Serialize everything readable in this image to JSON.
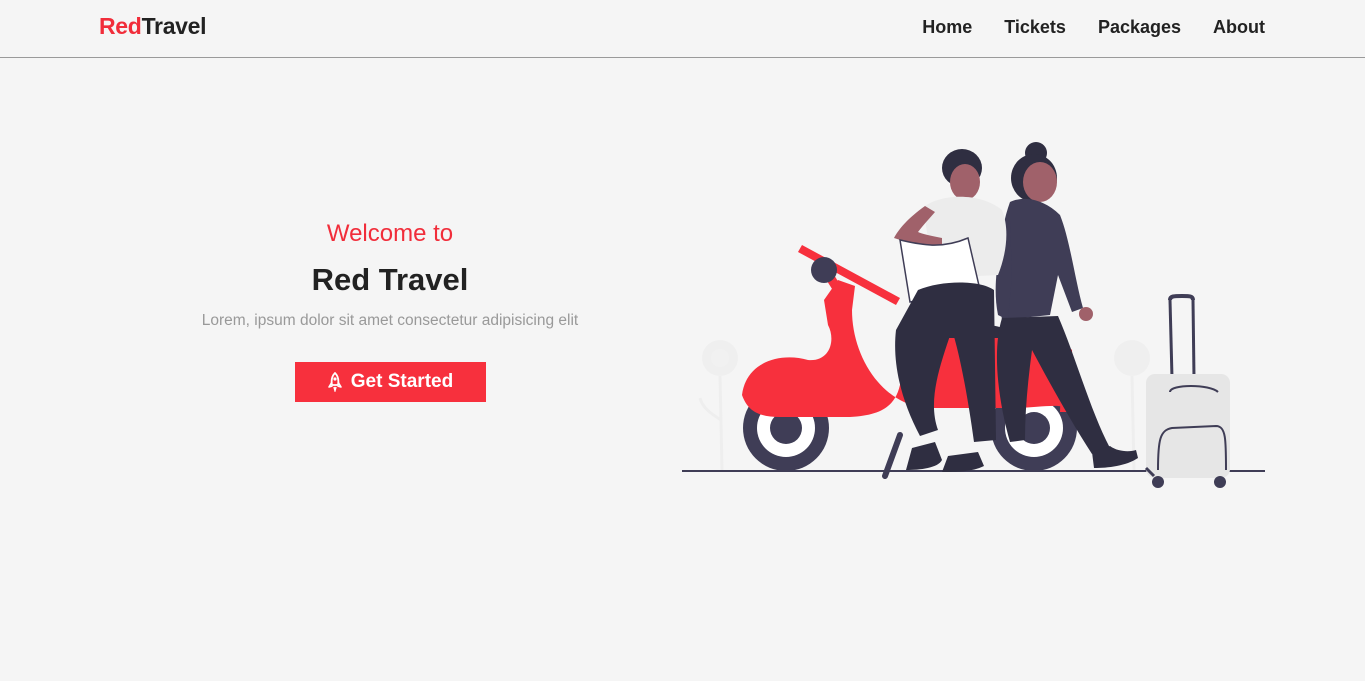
{
  "brand": {
    "part1": "Red",
    "part2": "Travel"
  },
  "nav": {
    "items": [
      {
        "label": "Home"
      },
      {
        "label": "Tickets"
      },
      {
        "label": "Packages"
      },
      {
        "label": "About"
      }
    ]
  },
  "hero": {
    "welcome": "Welcome to",
    "title": "Red Travel",
    "tagline": "Lorem, ipsum dolor sit amet consectetur adipisicing elit",
    "cta_label": "Get Started",
    "cta_icon": "rocket-icon"
  },
  "colors": {
    "accent": "#f7303d",
    "brand_red": "#f12d3a",
    "text_dark": "#222222",
    "background": "#f5f5f5"
  }
}
